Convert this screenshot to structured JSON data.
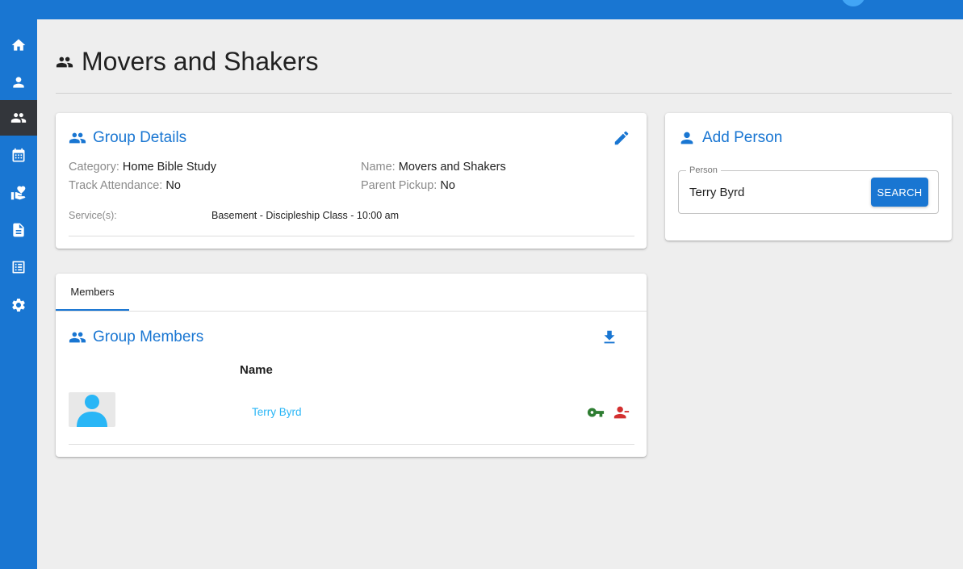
{
  "page": {
    "title": "Movers and Shakers",
    "title_icon": "group-icon"
  },
  "sidebar": {
    "items": [
      {
        "name": "home",
        "icon": "home-icon",
        "active": false
      },
      {
        "name": "people",
        "icon": "person-icon",
        "active": false
      },
      {
        "name": "groups",
        "icon": "group-icon",
        "active": true
      },
      {
        "name": "attendance",
        "icon": "calendar-icon",
        "active": false
      },
      {
        "name": "donations",
        "icon": "volunteer-icon",
        "active": false
      },
      {
        "name": "forms",
        "icon": "description-icon",
        "active": false
      },
      {
        "name": "reports",
        "icon": "list-alt-icon",
        "active": false
      },
      {
        "name": "settings",
        "icon": "gear-icon",
        "active": false
      }
    ]
  },
  "group_details": {
    "title": "Group Details",
    "category_label": "Category:",
    "category_value": "Home Bible Study",
    "name_label": "Name:",
    "name_value": "Movers and Shakers",
    "attendance_label": "Track Attendance:",
    "attendance_value": "No",
    "pickup_label": "Parent Pickup:",
    "pickup_value": "No",
    "services_label": "Service(s):",
    "services_value": "Basement - Discipleship Class - 10:00 am"
  },
  "add_person": {
    "title": "Add Person",
    "field_label": "Person",
    "field_value": "Terry Byrd",
    "search_label": "SEARCH"
  },
  "members": {
    "tab_label": "Members",
    "title": "Group Members",
    "column_name": "Name",
    "rows": [
      {
        "name": "Terry Byrd"
      }
    ]
  },
  "colors": {
    "primary": "#1976d2",
    "sidebar_active": "#33363b",
    "link": "#29b6f6",
    "key_icon": "#2e7d32",
    "remove_icon": "#d32f2f"
  }
}
